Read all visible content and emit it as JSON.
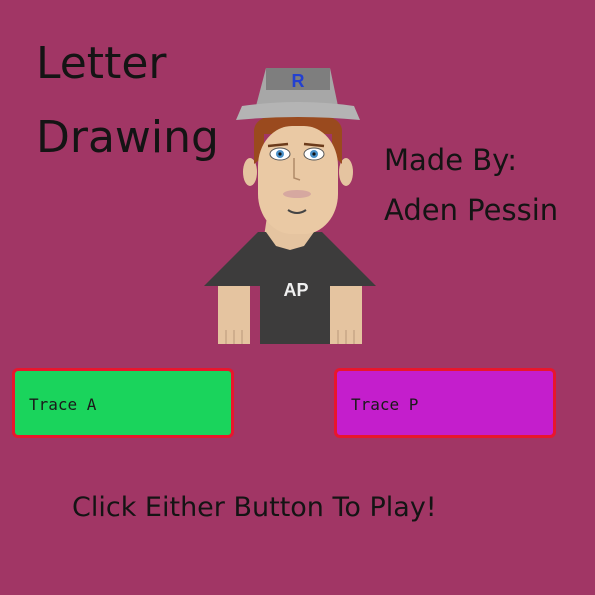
{
  "title": {
    "line1": "Letter",
    "line2": "Drawing"
  },
  "credits": {
    "line1": "Made By:",
    "line2": "Aden Pessin"
  },
  "avatar": {
    "hat_letter": "R",
    "shirt_text": "AP",
    "icon": "avatar-person"
  },
  "buttons": {
    "trace_a": "Trace A",
    "trace_p": "Trace P"
  },
  "prompt": "Click Either Button To Play!",
  "colors": {
    "background": "#a13665",
    "button_a": "#1ad45c",
    "button_p": "#c41ecc",
    "button_border": "#e8162d"
  }
}
